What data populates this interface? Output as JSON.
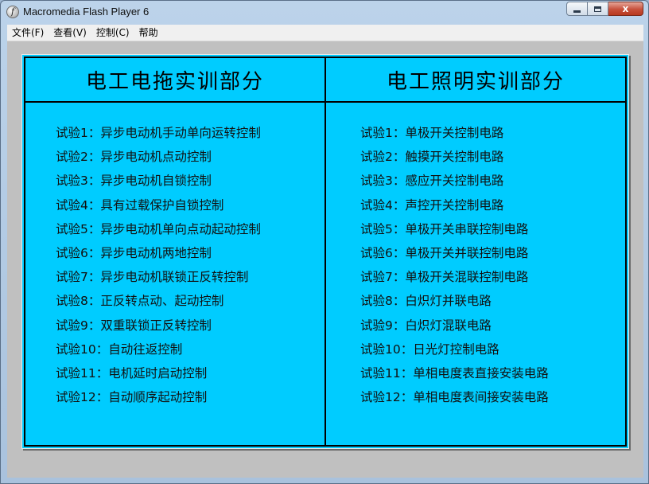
{
  "window": {
    "title": "Macromedia Flash Player 6",
    "icon": "flash-player-icon",
    "controls": {
      "minimize": "minimize-icon",
      "maximize": "maximize-icon",
      "close": "close-icon",
      "close_glyph": "x"
    }
  },
  "menu": {
    "items": [
      {
        "label": "文件(F)"
      },
      {
        "label": "查看(V)"
      },
      {
        "label": "控制(C)"
      },
      {
        "label": "帮助"
      }
    ]
  },
  "colors": {
    "stage_background": "#00ccff",
    "client_background": "#c0c0c0"
  },
  "left_panel": {
    "title": "电工电拖实训部分",
    "items": [
      "试验1：异步电动机手动单向运转控制",
      "试验2：异步电动机点动控制",
      "试验3：异步电动机自锁控制",
      "试验4：具有过载保护自锁控制",
      "试验5：异步电动机单向点动起动控制",
      "试验6：异步电动机两地控制",
      "试验7：异步电动机联锁正反转控制",
      "试验8：正反转点动、起动控制",
      "试验9：双重联锁正反转控制",
      "试验10：自动往返控制",
      "试验11：电机延时启动控制",
      "试验12：自动顺序起动控制"
    ]
  },
  "right_panel": {
    "title": "电工照明实训部分",
    "items": [
      "试验1：单极开关控制电路",
      "试验2：触摸开关控制电路",
      "试验3：感应开关控制电路",
      "试验4：声控开关控制电路",
      "试验5：单极开关串联控制电路",
      "试验6：单极开关并联控制电路",
      "试验7：单极开关混联控制电路",
      "试验8：白炽灯并联电路",
      "试验9：白炽灯混联电路",
      "试验10：日光灯控制电路",
      "试验11：单相电度表直接安装电路",
      "试验12：单相电度表间接安装电路"
    ]
  }
}
